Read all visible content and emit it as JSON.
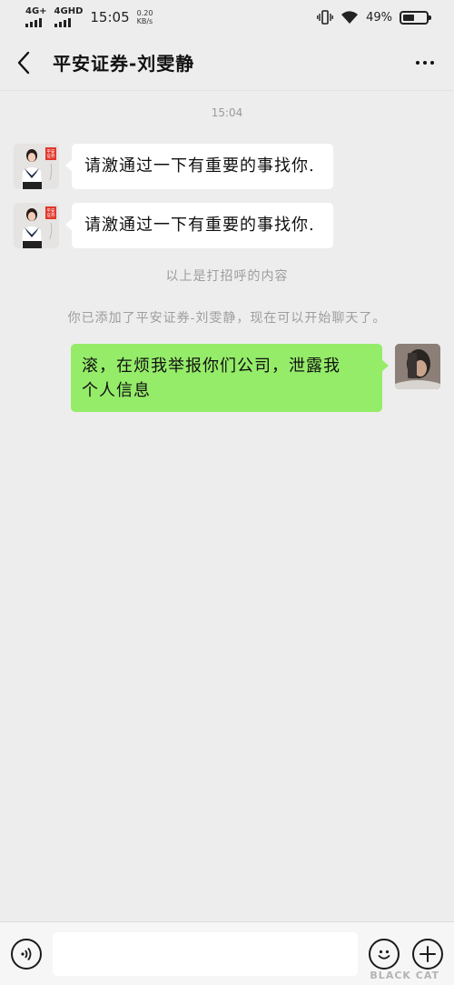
{
  "status_bar": {
    "network1": "4G+",
    "network2": "4GHD",
    "time": "15:05",
    "speed_value": "0.20",
    "speed_unit": "KB/s",
    "battery_percent": "49%",
    "battery_level": 0.49
  },
  "nav": {
    "title": "平安证券-刘雯静",
    "back_icon": "chevron-left-icon",
    "more_icon": "more-dots-icon"
  },
  "chat": {
    "timestamp": "15:04",
    "messages": [
      {
        "side": "left",
        "text": "请激通过一下有重要的事找你."
      },
      {
        "side": "left",
        "text": "请激通过一下有重要的事找你."
      },
      {
        "side": "right",
        "text_line1": "滚，在烦我举报你们公司，泄露我",
        "text_line2": "个人信息"
      }
    ],
    "system_greeting": "以上是打招呼的内容",
    "system_added": "你已添加了平安证券-刘雯静，现在可以开始聊天了。",
    "avatar_badge_line1": "平安",
    "avatar_badge_line2": "证券"
  },
  "input_bar": {
    "voice_icon": "voice-icon",
    "emoji_icon": "emoji-icon",
    "plus_icon": "plus-icon"
  },
  "watermark": "BLACK CAT"
}
